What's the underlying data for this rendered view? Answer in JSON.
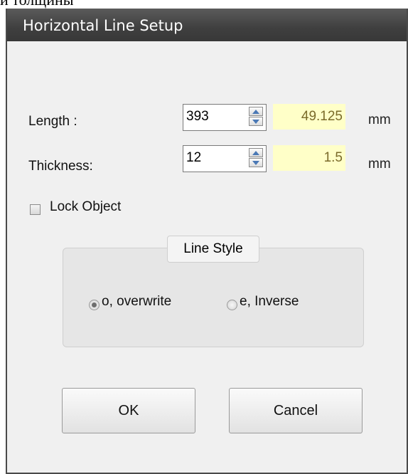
{
  "page_top_text": "и толщины",
  "window": {
    "title": "Horizontal Line Setup"
  },
  "length": {
    "label": "Length :",
    "value": "393",
    "mm_value": "49.125",
    "unit": "mm"
  },
  "thickness": {
    "label": "Thickness:",
    "value": "12",
    "mm_value": "1.5",
    "unit": "mm"
  },
  "lock_object": {
    "label": "Lock Object",
    "checked": false
  },
  "line_style": {
    "legend": "Line Style",
    "options": [
      {
        "label": "o, overwrite",
        "selected": true
      },
      {
        "label": "e, Inverse",
        "selected": false
      }
    ]
  },
  "buttons": {
    "ok": "OK",
    "cancel": "Cancel"
  },
  "colors": {
    "titlebar": "#3f3f3f",
    "readout_bg": "#ffffc8",
    "dialog_bg": "#f0f0f0"
  }
}
